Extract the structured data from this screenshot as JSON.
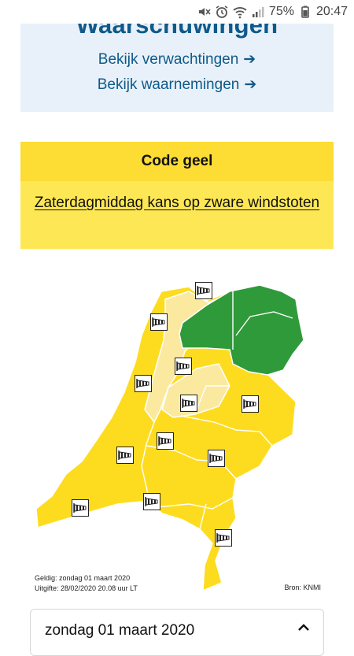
{
  "status_bar": {
    "battery": "75%",
    "time": "20:47",
    "icons": [
      "mute-icon",
      "alarm-icon",
      "wifi-icon",
      "signal-icon",
      "battery-icon"
    ]
  },
  "header": {
    "title": "Waarschuwingen",
    "link_forecast": "Bekijk verwachtingen",
    "link_observations": "Bekijk waarnemingen",
    "arrow": "➔"
  },
  "warning": {
    "code_label": "Code geel",
    "description": "Zaterdagmiddag kans op zware windstoten"
  },
  "map": {
    "valid": "Geldig: zondag 01 maart 2020",
    "issued": "Uitgifte: 28/02/2020 20.08 uur LT",
    "source": "Bron: KNMI",
    "colors": {
      "yellow": "#fddc1f",
      "light_yellow": "#fbe9a0",
      "green": "#2f9a3a",
      "border": "#ffffff"
    },
    "badge_icon": "windsock-icon"
  },
  "date_selector": {
    "label": "zondag 01 maart 2020"
  }
}
